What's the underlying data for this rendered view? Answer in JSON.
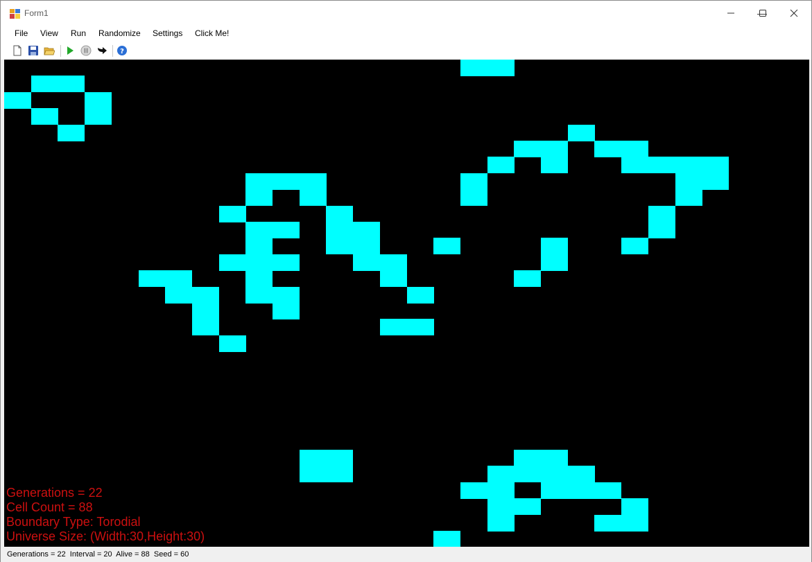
{
  "window": {
    "title": "Form1",
    "controls": {
      "minimize": "—",
      "maximize": "☐",
      "close": "✕"
    }
  },
  "menu": {
    "items": [
      "File",
      "View",
      "Run",
      "Randomize",
      "Settings",
      "Click Me!"
    ]
  },
  "toolbar": {
    "icons": [
      "new-file-icon",
      "save-icon",
      "open-folder-icon",
      "play-icon",
      "pause-icon",
      "next-step-icon",
      "help-icon"
    ]
  },
  "grid": {
    "cols": 30,
    "rows": 18,
    "alive_color": "#00ffff",
    "dead_color": "#000000",
    "alive_cells": [
      [
        17,
        0
      ],
      [
        18,
        0
      ],
      [
        1,
        1
      ],
      [
        2,
        1
      ],
      [
        0,
        2
      ],
      [
        3,
        2
      ],
      [
        1,
        3
      ],
      [
        3,
        3
      ],
      [
        2,
        4
      ],
      [
        21,
        4
      ],
      [
        19,
        5
      ],
      [
        20,
        5
      ],
      [
        22,
        5
      ],
      [
        23,
        5
      ],
      [
        18,
        6
      ],
      [
        20,
        6
      ],
      [
        23,
        6
      ],
      [
        24,
        6
      ],
      [
        25,
        6
      ],
      [
        26,
        6
      ],
      [
        9,
        7
      ],
      [
        10,
        7
      ],
      [
        11,
        7
      ],
      [
        17,
        7
      ],
      [
        25,
        7
      ],
      [
        26,
        7
      ],
      [
        9,
        8
      ],
      [
        11,
        8
      ],
      [
        17,
        8
      ],
      [
        25,
        8
      ],
      [
        8,
        9
      ],
      [
        12,
        9
      ],
      [
        24,
        9
      ],
      [
        9,
        10
      ],
      [
        10,
        10
      ],
      [
        12,
        10
      ],
      [
        13,
        10
      ],
      [
        24,
        10
      ],
      [
        9,
        11
      ],
      [
        12,
        11
      ],
      [
        13,
        11
      ],
      [
        16,
        11
      ],
      [
        20,
        11
      ],
      [
        23,
        11
      ],
      [
        8,
        12
      ],
      [
        9,
        12
      ],
      [
        10,
        12
      ],
      [
        13,
        12
      ],
      [
        14,
        12
      ],
      [
        20,
        12
      ],
      [
        5,
        13
      ],
      [
        6,
        13
      ],
      [
        9,
        13
      ],
      [
        14,
        13
      ],
      [
        19,
        13
      ],
      [
        6,
        14
      ],
      [
        7,
        14
      ],
      [
        9,
        14
      ],
      [
        10,
        14
      ],
      [
        15,
        14
      ],
      [
        7,
        15
      ],
      [
        10,
        15
      ],
      [
        7,
        16
      ],
      [
        14,
        16
      ],
      [
        15,
        16
      ],
      [
        8,
        17
      ]
    ],
    "alive_cells_bottom": [
      [
        11,
        0
      ],
      [
        12,
        0
      ],
      [
        19,
        0
      ],
      [
        20,
        0
      ],
      [
        11,
        1
      ],
      [
        12,
        1
      ],
      [
        18,
        1
      ],
      [
        19,
        1
      ],
      [
        20,
        1
      ],
      [
        21,
        1
      ],
      [
        17,
        2
      ],
      [
        18,
        2
      ],
      [
        20,
        2
      ],
      [
        21,
        2
      ],
      [
        22,
        2
      ],
      [
        18,
        3
      ],
      [
        19,
        3
      ],
      [
        23,
        3
      ],
      [
        18,
        4
      ],
      [
        22,
        4
      ],
      [
        23,
        4
      ],
      [
        16,
        5
      ]
    ]
  },
  "overlay": {
    "generations": "Generations = 22",
    "cell_count": "Cell Count = 88",
    "boundary": "Boundary Type: Torodial",
    "universe_size": "Universe Size: (Width:30,Height:30)"
  },
  "status": {
    "text": "Generations = 22  Interval = 20  Alive = 88  Seed = 60"
  }
}
